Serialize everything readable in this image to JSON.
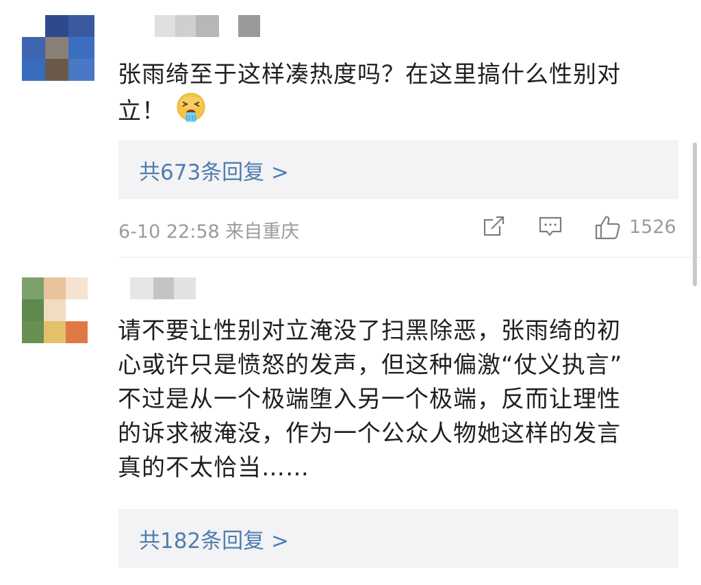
{
  "comments": [
    {
      "avatar_colors": [
        "#ffffff",
        "#2e4a8f",
        "#3a5aa0",
        "#3f65b0",
        "#8a7f76",
        "#3d6fc0",
        "#3a6cbd",
        "#6b5a4a",
        "#4a78c4"
      ],
      "name_blur_colors": [
        "#e0e0e0",
        "#cfcfcf",
        "#b7b7b7",
        "#ffffff",
        "#9a9a9a"
      ],
      "text_line1": "张雨绮至于这样凑热度吗？在这里搞什么性别对",
      "text_line2": "立！",
      "emoji": "vomiting-face-icon",
      "reply_label": "共673条回复 >",
      "meta": "6-10 22:58  来自重庆",
      "like_count": "1526"
    },
    {
      "avatar_colors": [
        "#7ea16b",
        "#e8c29a",
        "#f4e3d1",
        "#5f8a4d",
        "#f2dcc0",
        "#ffffff",
        "#6a8f52",
        "#e3c16a",
        "#e07a45"
      ],
      "name_blur_colors": [
        "#e6e6e6",
        "#c4c4c4",
        "#e2e2e2"
      ],
      "text_lines": [
        "请不要让性别对立淹没了扫黑除恶，张雨绮的初",
        "心或许只是愤怒的发声，但这种偏激“仗义执言”",
        "不过是从一个极端堕入另一个极端，反而让理性",
        "的诉求被淹没，作为一个公众人物她这样的发言",
        "真的不太恰当……"
      ],
      "reply_label": "共182条回复 >"
    }
  ],
  "icons": {
    "share": "share-icon",
    "comment": "comment-icon",
    "like": "thumbs-up-icon"
  },
  "colors": {
    "link": "#507daf",
    "meta": "#9b9b9b",
    "reply_bg": "#f3f3f5"
  }
}
